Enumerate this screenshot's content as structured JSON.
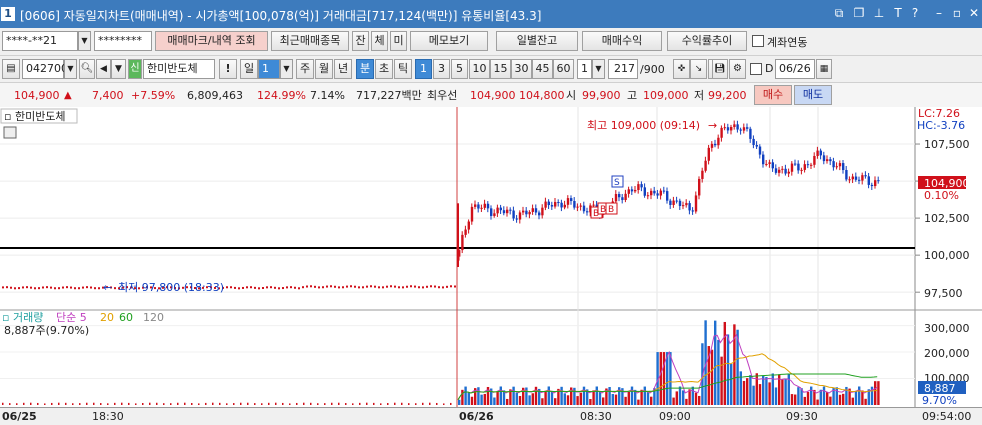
{
  "window": {
    "num": "1",
    "title": "[0606] 자동일지차트(매매내역) - 시가총액[100,078(억)] 거래대금[717,124(백만)] 유통비율[43.3]"
  },
  "row1": {
    "account": "****-**21",
    "password": "********",
    "btn_mark": "매매마크/내역 조회",
    "btn_recent": "최근매매종목",
    "btn_jan": "잔",
    "btn_che": "체",
    "btn_mi": "미",
    "btn_memo": "메모보기",
    "btn_daily": "일별잔고",
    "btn_profit": "매매수익",
    "btn_rate": "수익률추이",
    "chk_link": "계좌연동"
  },
  "row2": {
    "code": "042700",
    "sin": "신",
    "name": "한미반도체",
    "warn": "!",
    "period_il": "일",
    "period_val": "1",
    "ju": "주",
    "wol": "월",
    "nyeon": "년",
    "bun": "분",
    "cho": "초",
    "tik": "틱",
    "mins": [
      "1",
      "3",
      "5",
      "10",
      "15",
      "30",
      "45",
      "60"
    ],
    "interval": "1",
    "count": "217",
    "total": "/900",
    "chk_label": "D",
    "date": "06/26"
  },
  "quote": {
    "price": "104,900",
    "arrow": "▲",
    "change": "7,400",
    "pct": "+7.59%",
    "volume": "6,809,463",
    "vol_ratio": "124.99%",
    "turnover": "7.14%",
    "amount": "717,227백만",
    "best_label": "최우선",
    "ask": "104,900",
    "bid": "104,800",
    "open_label": "시",
    "open": "99,900",
    "high_label": "고",
    "high": "109,000",
    "low_label": "저",
    "low": "99,200",
    "buy": "매수",
    "sell": "매도"
  },
  "chart": {
    "stock": "한미반도체",
    "lc": "LC:7.26",
    "hc": "HC:-3.76",
    "high_anno": "최고 109,000 (09:14)",
    "low_anno": "최저 97,800 (18:33)",
    "price_box": "104,900",
    "price_pct": "0.10%",
    "y_ticks": [
      "107,500",
      "105,000",
      "102,500",
      "100,000",
      "97,500"
    ],
    "marks": [
      "S",
      "B",
      "B",
      "B"
    ]
  },
  "volume": {
    "title": "거래량",
    "ma": [
      "단순 5",
      "20",
      "60",
      "120"
    ],
    "value": "8,887주(9.70%)",
    "y_ticks": [
      "300,000",
      "200,000",
      "100,000"
    ],
    "box": "8,887",
    "pct": "9.70%"
  },
  "xaxis": {
    "labels": [
      "06/25",
      "18:30",
      "06/26",
      "08:30",
      "09:00",
      "09:30",
      "09:54:00"
    ]
  },
  "chart_data": {
    "type": "candlestick",
    "x": [
      "18:30",
      "06/26 08:00",
      "08:30",
      "09:00",
      "09:14",
      "09:30",
      "09:54"
    ],
    "close": [
      97800,
      102500,
      103200,
      104400,
      109000,
      106500,
      104900
    ],
    "high": 109000,
    "low": 97800,
    "ylim": [
      96500,
      110000
    ],
    "volume_ylim": [
      0,
      340000
    ]
  }
}
